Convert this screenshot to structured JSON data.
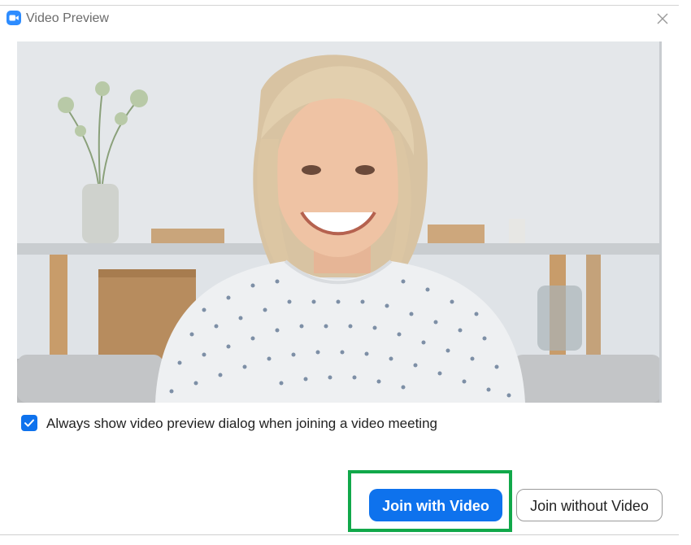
{
  "window": {
    "title": "Video Preview",
    "app_icon": "zoom-camera-icon",
    "close_icon": "close-icon"
  },
  "preview": {
    "content": "camera-video-feed"
  },
  "options": {
    "always_show_preview_label": "Always show video preview dialog when joining a video meeting",
    "always_show_preview_checked": true
  },
  "actions": {
    "join_with_video_label": "Join with Video",
    "join_without_video_label": "Join without Video"
  },
  "colors": {
    "accent": "#0e72ed",
    "highlight": "#11a84a",
    "app_icon_bg": "#2d8cff"
  }
}
